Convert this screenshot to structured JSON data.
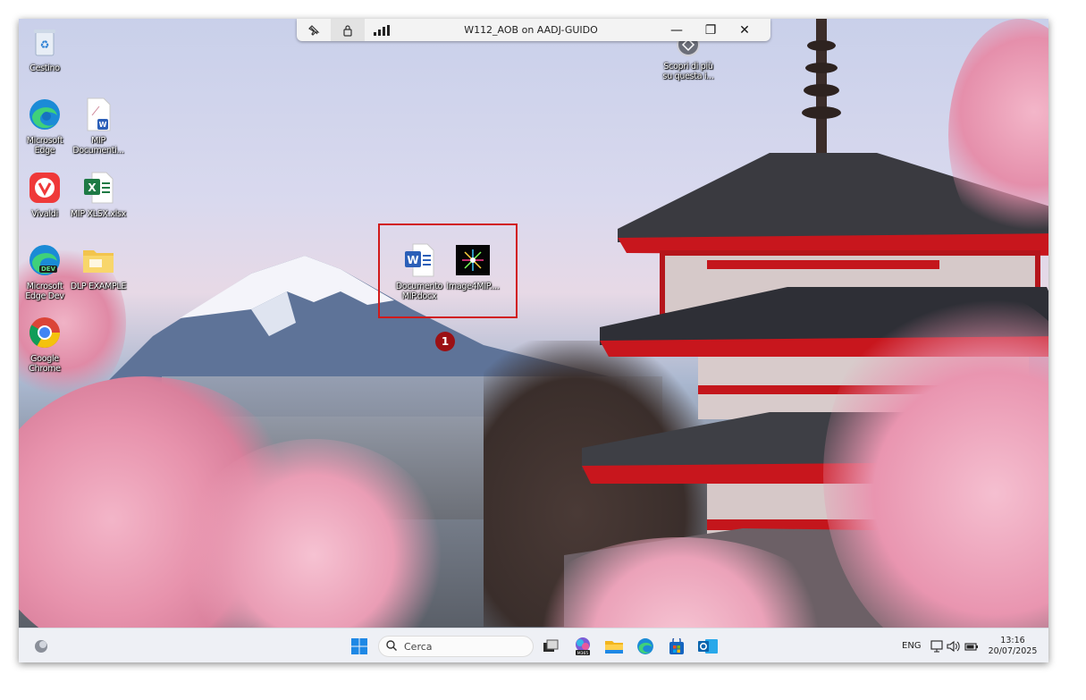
{
  "remote_bar": {
    "title": "W112_AOB on AADJ-GUIDO",
    "icons": [
      "unpin-icon",
      "lock-icon",
      "signal-icon"
    ],
    "minimize": "—",
    "restore": "❐",
    "close": "✕"
  },
  "desktop_icons": [
    {
      "name": "recycle-bin",
      "label": "Cestino",
      "icon": "recycle-bin-icon"
    },
    {
      "name": "microsoft-edge",
      "label": "Microsoft Edge",
      "icon": "edge-icon"
    },
    {
      "name": "mip-document",
      "label": "MIP Documenti...",
      "icon": "word-doc-icon"
    },
    {
      "name": "vivaldi",
      "label": "Vivaldi",
      "icon": "vivaldi-icon"
    },
    {
      "name": "mip-xlsx",
      "label": "MIP XLSX.xlsx",
      "icon": "excel-icon"
    },
    {
      "name": "edge-dev",
      "label": "Microsoft Edge Dev",
      "icon": "edge-dev-icon"
    },
    {
      "name": "dlp-example",
      "label": "DLP EXAMPLE",
      "icon": "folder-icon"
    },
    {
      "name": "google-chrome",
      "label": "Google Chrome",
      "icon": "chrome-icon"
    },
    {
      "name": "learn-more",
      "label": "Scopri di più su questa i...",
      "icon": "camera-icon"
    },
    {
      "name": "documento-mip",
      "label": "Documento MIP.docx",
      "icon": "word-doc-icon"
    },
    {
      "name": "image4mip",
      "label": "Image4MIP....",
      "icon": "image-thumb-icon"
    }
  ],
  "dev_badge": "DEV",
  "callout": "1",
  "taskbar": {
    "search_placeholder": "Cerca",
    "apps": [
      "task-view-icon",
      "m365-icon",
      "file-explorer-icon",
      "edge-icon",
      "store-icon",
      "outlook-icon"
    ],
    "m365_badge": "M365",
    "language": "ENG",
    "time": "13:16",
    "date": "20/07/2025"
  },
  "colors": {
    "highlight": "#d11a1a",
    "callout": "#9b1014",
    "taskbar": "#eef0f5"
  }
}
